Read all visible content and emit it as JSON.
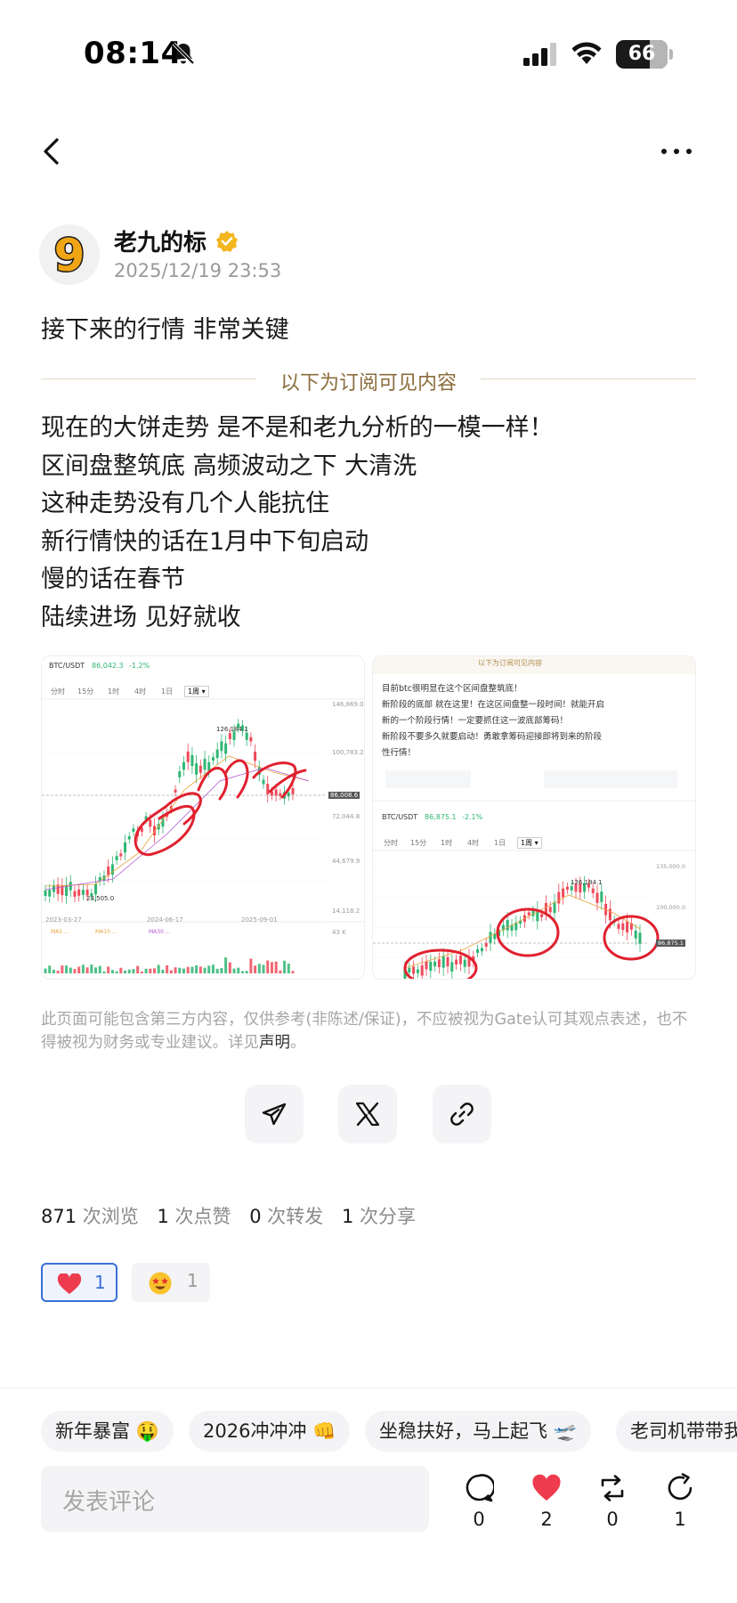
{
  "status": {
    "time": "08:14",
    "battery": "66",
    "battery_level": 0.66
  },
  "author": {
    "name": "老九的标",
    "time": "2025/12/19 23:53",
    "avatar_glyph": "9"
  },
  "post": {
    "title": "接下来的行情 非常关键",
    "subscribe_divider": "以下为订阅可见内容",
    "lines": [
      "现在的大饼走势 是不是和老九分析的一模一样！",
      "区间盘整筑底 高频波动之下 大清洗",
      "这种走势没有几个人能抗住",
      "新行情快的话在1月中下旬启动",
      "慢的话在春节",
      "陆续进场 见好就收"
    ]
  },
  "images": {
    "left": {
      "pair": "BTC/USDT",
      "price": "86,042.3",
      "change": "-1.2%",
      "tabs": [
        "分时",
        "15分",
        "1时",
        "4时",
        "1日",
        "1周 ▾"
      ],
      "high_label": "126,184.1",
      "low_label": "24,505.0",
      "price_tag": "86,008.6",
      "y_ticks": [
        "146,869.0",
        "100,783.2",
        "72,044.8",
        "44,679.9",
        "14,118.2",
        "43 K"
      ],
      "x_ticks": [
        "2023-03-27",
        "2024-06-17",
        "2025-09-01"
      ],
      "ma_labels": [
        "MA5 ...",
        "MA10 ...",
        "MA30 ..."
      ]
    },
    "right": {
      "header": "以下为订阅可见内容",
      "text_lines": [
        "目前btc很明显在这个区间盘整筑底！",
        "新阶段的底部 就在这里！在这区间盘整一段时间！就能开启",
        "新的一个阶段行情！一定要抓住这一波底部筹码！",
        "新阶段不要多久就要启动！勇敢拿筹码迎接即将到来的阶段",
        "性行情！"
      ],
      "pair": "BTC/USDT",
      "price": "86,875.1",
      "change": "-2.1%",
      "tabs": [
        "分时",
        "15分",
        "1时",
        "4时",
        "1日",
        "1周 ▾"
      ],
      "high_label": "126,184.1",
      "y_ticks": [
        "135,000.0",
        "100,000.0",
        "86,875.1"
      ]
    }
  },
  "disclaimer": {
    "text": "此页面可能包含第三方内容，仅供参考(非陈述/保证)，不应被视为Gate认可其观点表述，也不得被视为财务或专业建议。详见",
    "link": "声明",
    "end": "。"
  },
  "share": {
    "buttons": [
      "telegram-icon",
      "x-icon",
      "link-icon"
    ]
  },
  "stats": {
    "views": "871",
    "views_label": "次浏览",
    "likes": "1",
    "likes_label": "次点赞",
    "reposts": "0",
    "reposts_label": "次转发",
    "shares": "1",
    "shares_label": "次分享"
  },
  "reactions": [
    {
      "icon": "heart-icon",
      "count": "1",
      "selected": true
    },
    {
      "icon": "star-eyes-icon",
      "count": "1",
      "selected": false
    }
  ],
  "tags": [
    "新年暴富 🤑",
    "2026冲冲冲 👊",
    "坐稳扶好，马上起飞 🛫",
    "老司机带带我"
  ],
  "comment": {
    "placeholder": "发表评论"
  },
  "actions": {
    "comments": "0",
    "likes": "2",
    "reposts": "0",
    "shares": "1"
  },
  "colors": {
    "accent_gold": "#8b6d3c",
    "like_red": "#ee3b4e",
    "selected_blue": "#3a6fd8",
    "candle_green": "#2fb673",
    "candle_red": "#ee4a5a",
    "annotation_red": "#e0212f"
  }
}
